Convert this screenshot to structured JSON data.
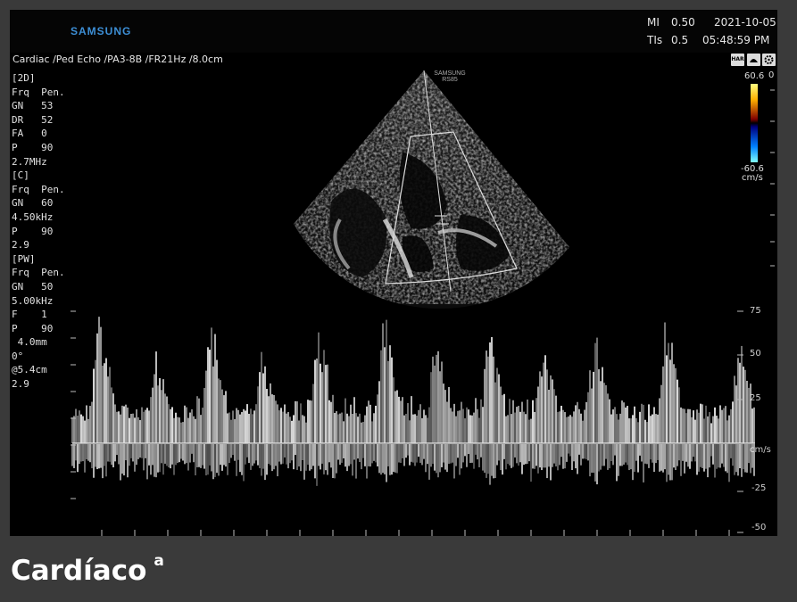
{
  "header": {
    "brand": "SAMSUNG",
    "mi_label": "MI",
    "mi_value": "0.50",
    "date": "2021-10-05",
    "tis_label": "TIs",
    "tis_value": "0.5",
    "time": "05:48:59 PM"
  },
  "probe_line": "Cardiac /Ped Echo /PA3-8B /FR21Hz /8.0cm",
  "sector_brand": [
    "SAMSUNG",
    "RS85"
  ],
  "params": [
    "[2D]",
    "Frq  Pen.",
    "GN   53",
    "DR   52",
    "FA   0",
    "P    90",
    "2.7MHz",
    "[C]",
    "Frq  Pen.",
    "GN   60",
    "4.50kHz",
    "P    90",
    "2.9",
    "[PW]",
    "Frq  Pen.",
    "GN   50",
    "5.00kHz",
    "F    1",
    "P    90",
    " 4.0mm",
    "0°",
    "@5.4cm",
    "2.9"
  ],
  "color_scale": {
    "max": "60.6",
    "min": "-60.6",
    "unit": "cm/s",
    "zero": "0"
  },
  "toolbar_icons": [
    {
      "name": "har-icon",
      "label": "HAR"
    },
    {
      "name": "probe-icon",
      "label": ""
    },
    {
      "name": "settings-icon",
      "label": ""
    }
  ],
  "doppler_scale": {
    "ticks": [
      "75",
      "50",
      "25",
      "-25",
      "-50"
    ],
    "unit": "cm/s"
  },
  "caption": {
    "title": "Cardíaco",
    "sup": "a"
  }
}
